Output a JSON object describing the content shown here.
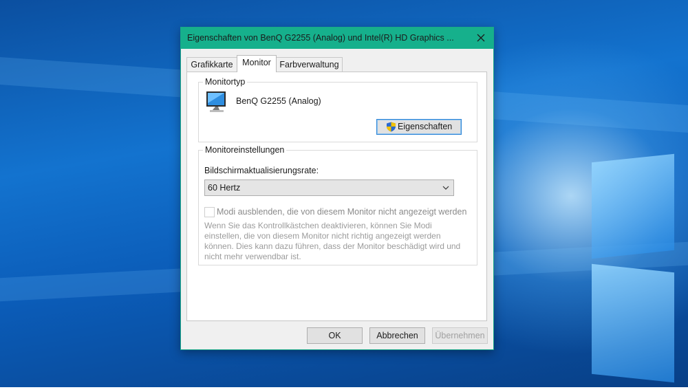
{
  "dialog": {
    "title": "Eigenschaften von BenQ G2255 (Analog) und Intel(R) HD Graphics ...",
    "tabs": [
      {
        "label": "Grafikkarte",
        "active": false
      },
      {
        "label": "Monitor",
        "active": true
      },
      {
        "label": "Farbverwaltung",
        "active": false
      }
    ],
    "monitor_type": {
      "legend": "Monitortyp",
      "monitor_name": "BenQ G2255 (Analog)",
      "properties_button": "Eigenschaften"
    },
    "monitor_settings": {
      "legend": "Monitoreinstellungen",
      "refresh_rate_label": "Bildschirmaktualisierungsrate:",
      "refresh_rate_value": "60 Hertz",
      "hide_modes_label": "Modi ausblenden, die von diesem Monitor nicht angezeigt werden",
      "hide_modes_checked": false,
      "warning_text": "Wenn Sie das Kontrollkästchen deaktivieren, können Sie Modi einstellen, die von diesem Monitor nicht richtig angezeigt werden können. Dies kann dazu führen, dass der Monitor beschädigt wird und nicht mehr verwendbar ist."
    },
    "buttons": {
      "ok": "OK",
      "cancel": "Abbrechen",
      "apply": "Übernehmen"
    }
  },
  "colors": {
    "titlebar": "#16b08c",
    "desktop": "#0b5cb8",
    "focus_border": "#2f86d6"
  }
}
